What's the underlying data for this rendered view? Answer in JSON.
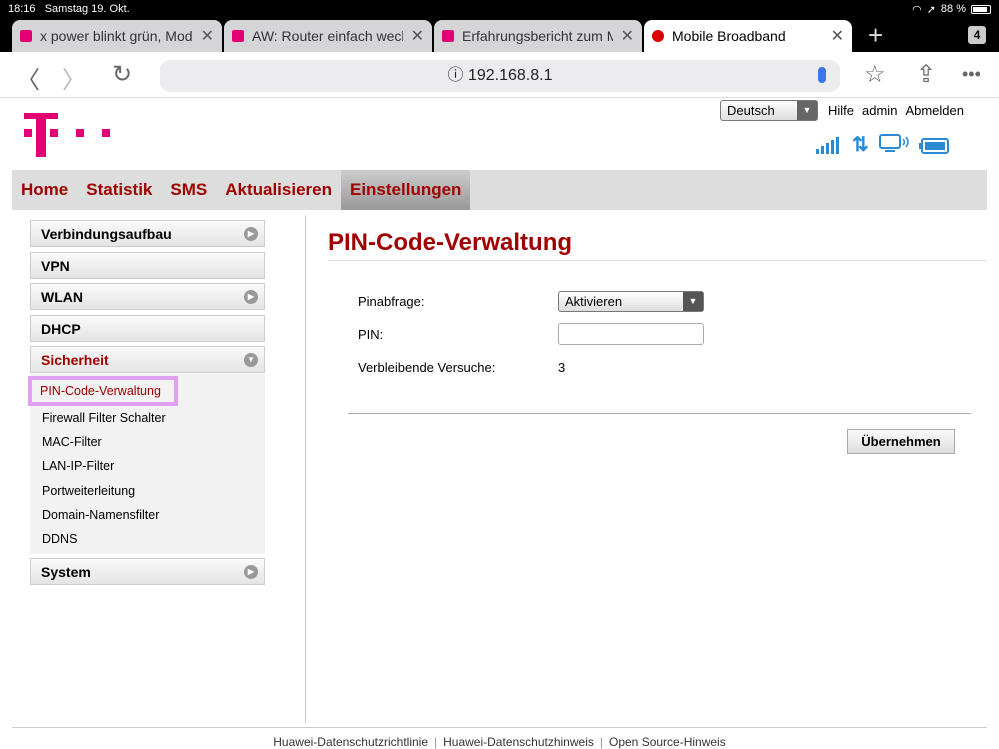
{
  "status": {
    "time": "18:16",
    "date": "Samstag 19. Okt.",
    "battery": "88 %",
    "battery_level": 0.88
  },
  "tabs": [
    {
      "title": "x power blinkt grün, Mode",
      "active": false
    },
    {
      "title": "AW: Router einfach wechs",
      "active": false
    },
    {
      "title": "Erfahrungsbericht zum M",
      "active": false
    },
    {
      "title": "Mobile Broadband",
      "active": true
    }
  ],
  "tab_count": "4",
  "url": "192.168.8.1",
  "header": {
    "language": "Deutsch",
    "links": [
      "Hilfe",
      "admin",
      "Abmelden"
    ]
  },
  "nav": [
    "Home",
    "Statistik",
    "SMS",
    "Aktualisieren",
    "Einstellungen"
  ],
  "nav_active": "Einstellungen",
  "sidebar": {
    "items": [
      "Verbindungsaufbau",
      "VPN",
      "WLAN",
      "DHCP",
      "Sicherheit",
      "System"
    ],
    "sub": [
      "PIN-Code-Verwaltung",
      "Firewall Filter Schalter",
      "MAC-Filter",
      "LAN-IP-Filter",
      "Portweiterleitung",
      "Domain-Namensfilter",
      "DDNS"
    ]
  },
  "main": {
    "title": "PIN-Code-Verwaltung",
    "pinabfrage_label": "Pinabfrage:",
    "pinabfrage_value": "Aktivieren",
    "pin_label": "PIN:",
    "pin_value": "",
    "remaining_label": "Verbleibende Versuche:",
    "remaining_value": "3",
    "apply": "Übernehmen"
  },
  "footer": [
    "Huawei-Datenschutzrichtlinie",
    "Huawei-Datenschutzhinweis",
    "Open Source-Hinweis"
  ],
  "colors": {
    "accent": "#a00000",
    "brand": "#e20074",
    "highlight": "#e0a0f0"
  }
}
